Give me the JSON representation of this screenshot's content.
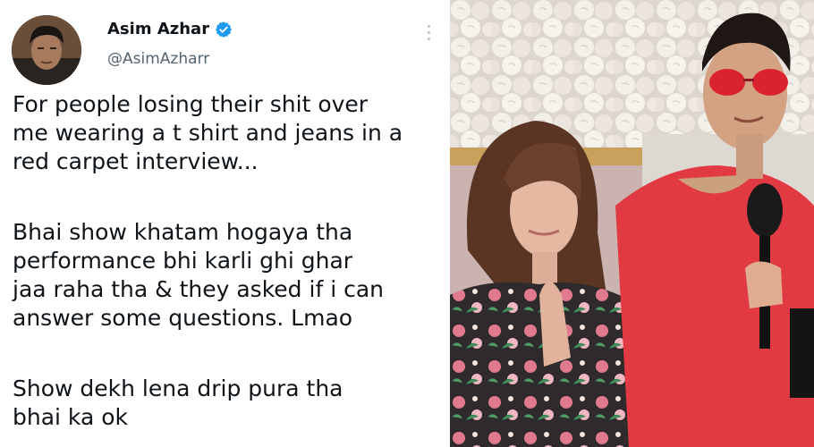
{
  "tweet": {
    "display_name": "Asim Azhar",
    "handle": "@AsimAzharr",
    "verified_icon": "verified-badge-icon",
    "more_icon": "more-options-icon",
    "paragraphs": [
      "For people losing their shit over\nme wearing a t shirt and jeans in a\nred carpet interview...",
      "Bhai show khatam hogaya tha\nperformance bhi karli ghi ghar\njaa raha tha & they asked if i can\nanswer some questions. Lmao",
      "Show dekh lena drip pura tha\nbhai ka ok"
    ]
  },
  "colors": {
    "verified": "#1d9bf0",
    "text": "#0f1419",
    "handle": "#536471",
    "tshirt": "#e23a42",
    "sunglasses": "#d9232e"
  }
}
